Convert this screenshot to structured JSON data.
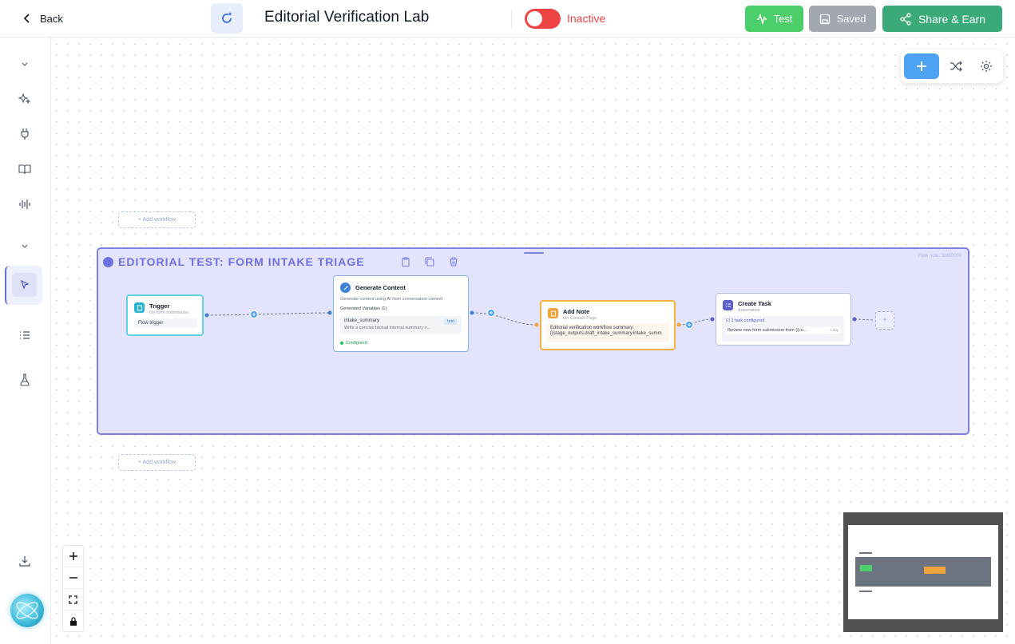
{
  "header": {
    "back_label": "Back",
    "title": "Editorial Verification Lab",
    "status": "Inactive",
    "test_label": "Test",
    "saved_label": "Saved",
    "share_label": "Share & Earn"
  },
  "canvas": {
    "add_workflow_label": "+ Add workflow",
    "group": {
      "title": "EDITORIAL TEST: FORM INTAKE TRIAGE",
      "meta": "Flow note: 3d6f0000"
    },
    "nodes": {
      "trigger": {
        "title": "Trigger",
        "subtitle": "On form submission",
        "body": "Flow trigger"
      },
      "generate": {
        "title": "Generate Content",
        "description": "Generate content using AI from conversation context",
        "vars_label": "Generated Variables (1)",
        "var_name": "intake_summary",
        "var_type": "text",
        "var_desc": "Write a concise factual internal summary o...",
        "status": "Configured"
      },
      "note": {
        "title": "Add Note",
        "subtitle": "On Contact Page",
        "line1": "Editorial verification workflow summary:",
        "line2": "{{stage_outputs.draft_intake_summary.intake_summ"
      },
      "task": {
        "title": "Create Task",
        "subtitle": "Automation",
        "configured": "1 task configured",
        "detail": "Review new form submission from {{co...",
        "due": "1 day",
        "due_unit": "day"
      }
    }
  },
  "colors": {
    "accent_blue": "#4da3f2",
    "inactive_red": "#ef4444",
    "test_green": "#4ccf6b",
    "share_green": "#3aaa78",
    "group_purple": "#7d80e0"
  }
}
